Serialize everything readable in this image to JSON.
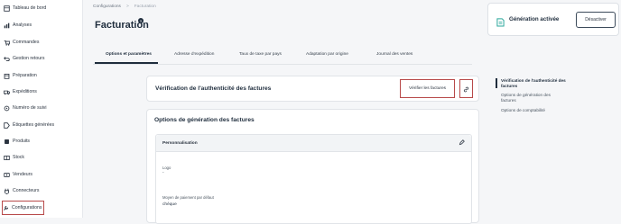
{
  "sidebar": {
    "items": [
      {
        "label": "Tableau de bord",
        "icon": "dashboard-icon"
      },
      {
        "label": "Analyses",
        "icon": "chart-icon"
      },
      {
        "label": "Commandes",
        "icon": "cart-icon"
      },
      {
        "label": "Gestion retours",
        "icon": "return-icon"
      },
      {
        "label": "Préparation",
        "icon": "box-icon"
      },
      {
        "label": "Expéditions",
        "icon": "truck-icon"
      },
      {
        "label": "Numéro de suivi",
        "icon": "tracking-icon"
      },
      {
        "label": "Étiquettes générées",
        "icon": "label-icon"
      },
      {
        "label": "Produits",
        "icon": "product-icon"
      },
      {
        "label": "Stock",
        "icon": "stock-icon"
      },
      {
        "label": "Vendeurs",
        "icon": "seller-icon"
      },
      {
        "label": "Connecteurs",
        "icon": "plug-icon"
      },
      {
        "label": "Configurations",
        "icon": "settings-icon"
      }
    ]
  },
  "header": {
    "breadcrumb": [
      "Configurations",
      "Facturation"
    ],
    "title": "Facturation",
    "help_icon": "?"
  },
  "status": {
    "label": "Génération activée",
    "button": "Désactiver"
  },
  "tabs": [
    "Options et paramètres",
    "Adresse d'expédition",
    "Taux de taxe par pays",
    "Adaptation par origine",
    "Journal des ventes"
  ],
  "verify": {
    "title": "Vérification de l'authenticité des factures",
    "button": "Vérifier les factures"
  },
  "options": {
    "title": "Options de génération des factures",
    "section": "Personnalisation",
    "fields": [
      {
        "label": "Logo",
        "value": "-"
      },
      {
        "label": "Moyen de paiement par défaut",
        "value": "chèque"
      }
    ]
  },
  "right_nav": [
    "Vérification de l'authenticité des factures",
    "Options de génération des factures",
    "Options de comptabilité"
  ]
}
